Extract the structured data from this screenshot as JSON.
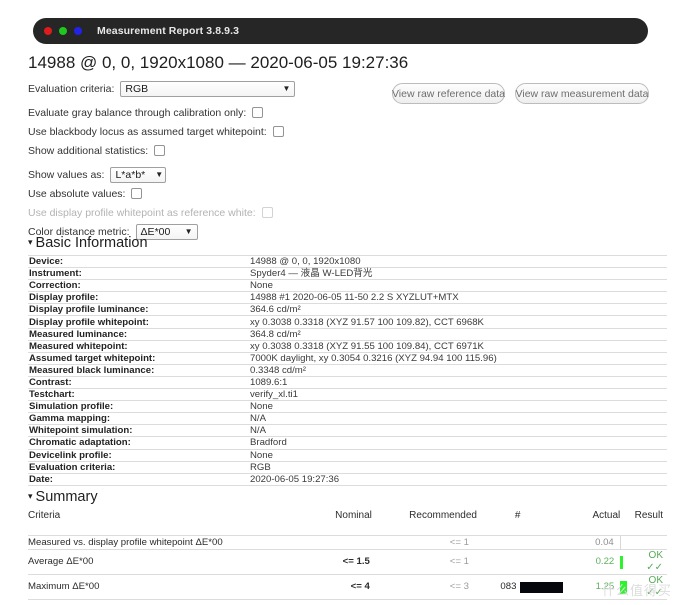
{
  "window": {
    "title": "Measurement Report 3.8.9.3",
    "traffic_lights": [
      "close-red",
      "minimize-green",
      "zoom-blue"
    ]
  },
  "report": {
    "heading": "14988 @ 0, 0, 1920x1080 — 2020-06-05 19:27:36"
  },
  "options": {
    "evaluation_criteria_label": "Evaluation criteria:",
    "evaluation_criteria_value": "RGB",
    "gray_balance_label": "Evaluate gray balance through calibration only:",
    "blackbody_label": "Use blackbody locus as assumed target whitepoint:",
    "additional_stats_label": "Show additional statistics:",
    "show_values_label": "Show values as:",
    "show_values_value": "L*a*b*",
    "absolute_values_label": "Use absolute values:",
    "display_profile_wp_label": "Use display profile whitepoint as reference white:",
    "color_distance_label": "Color distance metric:",
    "color_distance_value": "ΔE*00",
    "caret": "⌄"
  },
  "buttons": {
    "view_raw_reference": "View raw reference data",
    "view_raw_measurement": "View raw measurement data"
  },
  "sections": {
    "basic_information": "Basic Information",
    "summary": "Summary",
    "triangle": "▾"
  },
  "basic_information": [
    {
      "key": "Device:",
      "value": "14988 @ 0, 0, 1920x1080"
    },
    {
      "key": "Instrument:",
      "value": "Spyder4 — 液晶 W-LED背光"
    },
    {
      "key": "Correction:",
      "value": "None"
    },
    {
      "key": "Display profile:",
      "value": "14988 #1 2020-06-05 11-50 2.2 S XYZLUT+MTX"
    },
    {
      "key": "Display profile luminance:",
      "value": "364.6 cd/m²"
    },
    {
      "key": "Display profile whitepoint:",
      "value": "xy 0.3038 0.3318 (XYZ 91.57 100 109.82), CCT 6968K"
    },
    {
      "key": "Measured luminance:",
      "value": "364.8 cd/m²"
    },
    {
      "key": "Measured whitepoint:",
      "value": "xy 0.3038 0.3318 (XYZ 91.55 100 109.84), CCT 6971K"
    },
    {
      "key": "Assumed target whitepoint:",
      "value": "7000K daylight, xy 0.3054 0.3216 (XYZ 94.94 100 115.96)"
    },
    {
      "key": "Measured black luminance:",
      "value": "0.3348 cd/m²"
    },
    {
      "key": "Contrast:",
      "value": "1089.6:1"
    },
    {
      "key": "Testchart:",
      "value": "verify_xl.ti1"
    },
    {
      "key": "Simulation profile:",
      "value": "None"
    },
    {
      "key": "Gamma mapping:",
      "value": "N/A"
    },
    {
      "key": "Whitepoint simulation:",
      "value": "N/A"
    },
    {
      "key": "Chromatic adaptation:",
      "value": "Bradford"
    },
    {
      "key": "Devicelink profile:",
      "value": "None"
    },
    {
      "key": "Evaluation criteria:",
      "value": "RGB"
    },
    {
      "key": "Date:",
      "value": "2020-06-05 19:27:36"
    }
  ],
  "summary": {
    "columns": [
      "Criteria",
      "Nominal",
      "Recommended",
      "#",
      "Actual",
      "Result"
    ],
    "rows": [
      {
        "criteria": "Measured vs. display profile whitepoint ΔE*00",
        "nominal": "",
        "recommended": "<= 1",
        "hash": "",
        "swatch": "",
        "actual": "0.04",
        "actual_state": "gray",
        "bar": "none",
        "result": ""
      },
      {
        "criteria": "Average ΔE*00",
        "nominal": "<= 1.5",
        "recommended": "<= 1",
        "hash": "",
        "swatch": "",
        "actual": "0.22",
        "actual_state": "green",
        "bar": "thin",
        "result": "OK ✓✓"
      },
      {
        "criteria": "Maximum ΔE*00",
        "nominal": "<= 4",
        "recommended": "<= 3",
        "hash": "083",
        "swatch": "#06060d",
        "actual": "1.25",
        "actual_state": "green",
        "bar": "full",
        "result": "OK ✓✓"
      }
    ]
  },
  "watermark": "什么值得买",
  "colors": {
    "titlebar_bg": "#262626",
    "accent_green": "#2df32d",
    "ok_green": "#58ab58",
    "muted_gray": "#9c9c9c"
  }
}
